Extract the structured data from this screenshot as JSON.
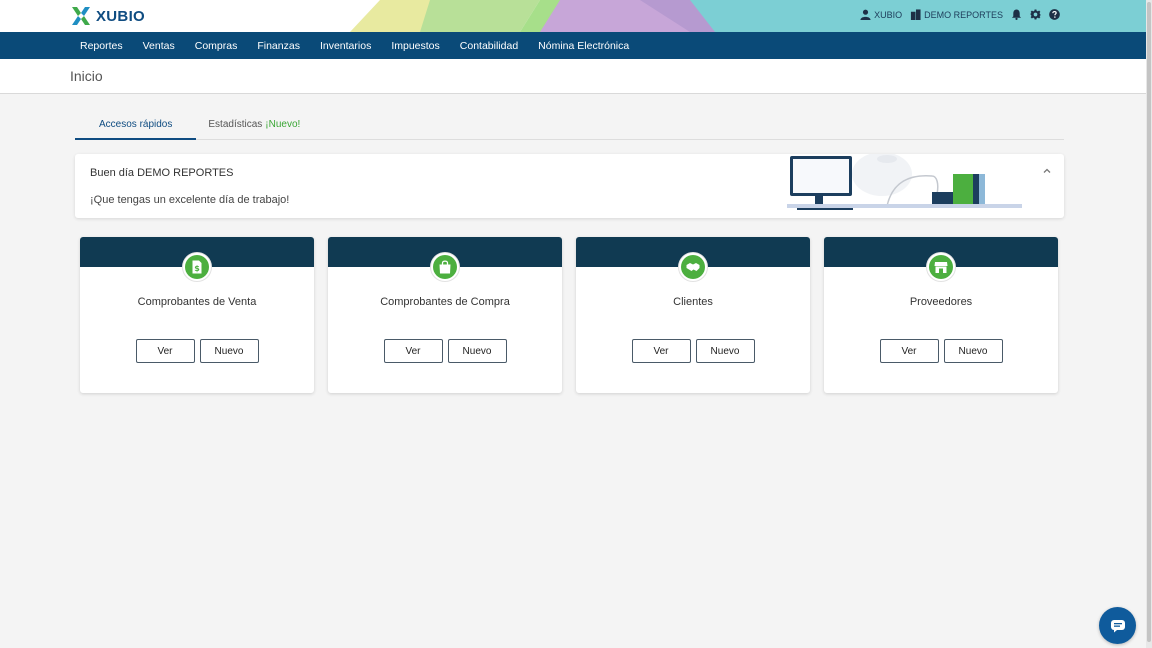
{
  "brand": {
    "name": "XUBIO"
  },
  "header": {
    "user_label": "XUBIO",
    "company_label": "DEMO REPORTES"
  },
  "nav": {
    "items": [
      "Reportes",
      "Ventas",
      "Compras",
      "Finanzas",
      "Inventarios",
      "Impuestos",
      "Contabilidad",
      "Nómina Electrónica"
    ]
  },
  "page": {
    "title": "Inicio"
  },
  "tabs": {
    "quick_access": "Accesos rápidos",
    "stats": "Estadísticas",
    "stats_badge": "¡Nuevo!"
  },
  "welcome": {
    "greeting": "Buen día DEMO REPORTES",
    "message": "¡Que tengas un excelente día de trabajo!"
  },
  "cards": [
    {
      "title": "Comprobantes de Venta",
      "icon": "invoice-dollar-icon",
      "view": "Ver",
      "new": "Nuevo"
    },
    {
      "title": "Comprobantes de Compra",
      "icon": "shopping-bag-icon",
      "view": "Ver",
      "new": "Nuevo"
    },
    {
      "title": "Clientes",
      "icon": "handshake-icon",
      "view": "Ver",
      "new": "Nuevo"
    },
    {
      "title": "Proveedores",
      "icon": "store-icon",
      "view": "Ver",
      "new": "Nuevo"
    }
  ],
  "colors": {
    "nav_bg": "#0a4a78",
    "card_header": "#103a52",
    "accent_green": "#4caf3f",
    "badge_green": "#3aa635"
  }
}
